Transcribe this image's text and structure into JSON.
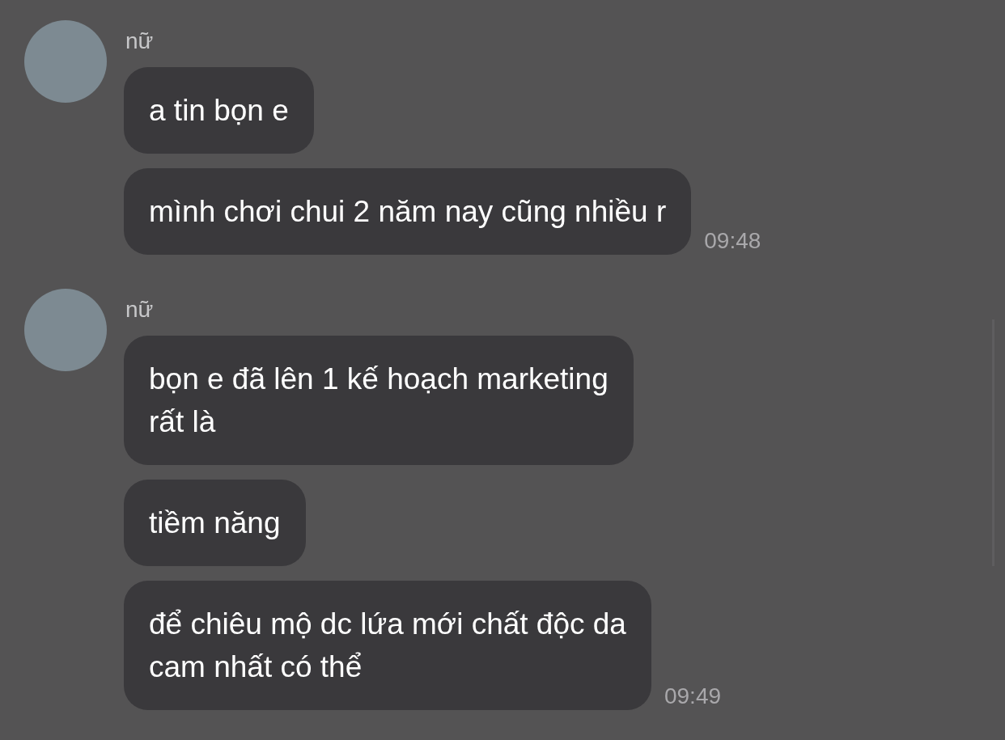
{
  "groups": [
    {
      "sender": "nữ",
      "messages": [
        "a tin bọn e",
        "mình chơi chui 2 năm nay cũng nhiều r"
      ],
      "time": "09:48"
    },
    {
      "sender": "nữ",
      "messages": [
        "bọn e đã lên 1 kế hoạch marketing\nrất là",
        "tiềm năng",
        "để chiêu mộ dc lứa mới chất độc da\ncam nhất có thể"
      ],
      "time": "09:49"
    }
  ]
}
